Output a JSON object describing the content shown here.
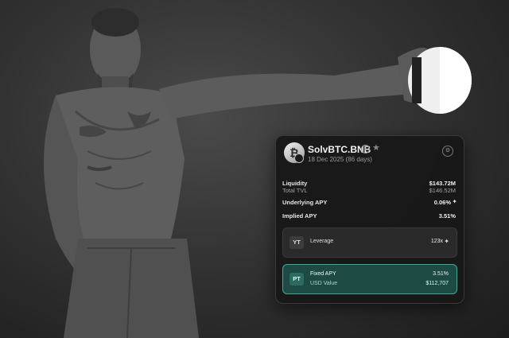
{
  "card": {
    "title": "SolvBTC.BNB",
    "date": "18 Dec 2025 (86 days)",
    "coin_icon": "bitcoin-icon",
    "rows": {
      "liquidity_label": "Liquidity",
      "liquidity_value": "$143.72M",
      "tvl_label": "Total TVL",
      "tvl_value": "$146.52M",
      "underlying_label": "Underlying APY",
      "underlying_value": "0.06%",
      "implied_label": "Implied APY",
      "implied_value": "3.51%"
    },
    "yt": {
      "tag": "YT",
      "label": "Leverage",
      "value": "123x"
    },
    "pt": {
      "tag": "PT",
      "label": "Fixed APY",
      "value": "3.51%",
      "sub_label": "USD Value",
      "sub_value": "$112,707"
    }
  },
  "colors": {
    "card_bg": "#181818",
    "pt_accent": "#3ea896",
    "pt_bg": "#1e4a44"
  }
}
